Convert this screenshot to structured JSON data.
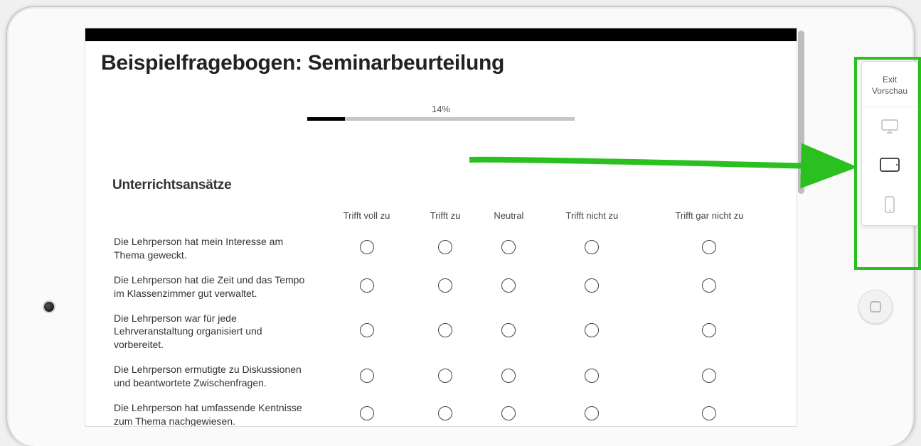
{
  "survey": {
    "title": "Beispielfragebogen: Seminarbeurteilung",
    "progress_label": "14%",
    "progress_percent": 14,
    "section_heading": "Unterrichtsansätze",
    "scale": [
      "Trifft voll zu",
      "Trifft zu",
      "Neutral",
      "Trifft nicht zu",
      "Trifft gar nicht zu"
    ],
    "statements": [
      "Die Lehrperson hat mein Interesse am Thema geweckt.",
      "Die Lehrperson hat die Zeit und das Tempo im Klassenzimmer gut verwaltet.",
      "Die Lehrperson war für jede Lehrveranstaltung organisiert und vorbereitet.",
      "Die Lehrperson ermutigte zu Diskussionen und beantwortete Zwischenfragen.",
      "Die Lehrperson hat umfassende Kentnisse zum Thema nachgewiesen."
    ]
  },
  "side_panel": {
    "exit_label": "Exit Vorschau",
    "devices": [
      "desktop",
      "tablet",
      "phone"
    ],
    "active_device": "tablet"
  },
  "annotation": {
    "highlight": "device-switcher"
  }
}
